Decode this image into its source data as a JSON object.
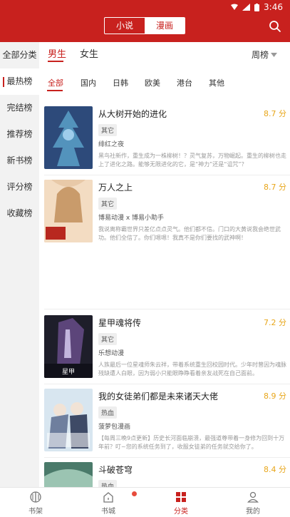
{
  "status": {
    "time": "3:46"
  },
  "header": {
    "segments": [
      {
        "label": "小说"
      },
      {
        "label": "漫画"
      }
    ],
    "active_segment": "漫画"
  },
  "sidebar": {
    "items": [
      {
        "label": "全部分类"
      },
      {
        "label": "最热榜"
      },
      {
        "label": "完结榜"
      },
      {
        "label": "推荐榜"
      },
      {
        "label": "新书榜"
      },
      {
        "label": "评分榜"
      },
      {
        "label": "收藏榜"
      }
    ],
    "active": "最热榜"
  },
  "filters": {
    "genders": [
      {
        "label": "男生"
      },
      {
        "label": "女生"
      }
    ],
    "rank_label": "周榜",
    "categories": [
      {
        "label": "全部"
      },
      {
        "label": "国内"
      },
      {
        "label": "日韩"
      },
      {
        "label": "欧美"
      },
      {
        "label": "港台"
      },
      {
        "label": "其他"
      }
    ]
  },
  "books": [
    {
      "title": "从大树开始的进化",
      "score": "8.7 分",
      "tag": "其它",
      "author": "绯红之夜",
      "desc": "黑鸟社新作，重生成为一株柳树！？灵气复苏，万物崛起。重生的柳树也走上了进化之路。能够无限进化的它，是“神力”还是“诅咒”？",
      "cover_colors": [
        "#2d4a7a",
        "#5aa0c8"
      ]
    },
    {
      "title": "万人之上",
      "score": "8.7 分",
      "tag": "其它",
      "author": "博易动漫 x 博易小助手",
      "desc": "我说离称霸世界只差亿点点灵气。他们都不信。门口的大黄说我会绝世武功。他们全信了。你们嗯嗯！我真不是你们要找的武神啊！",
      "cover_colors": [
        "#e8c9a8",
        "#b87b5a"
      ]
    },
    {
      "title": "星甲魂将传",
      "score": "7.2 分",
      "tag": "其它",
      "author": "乐想动漫",
      "desc": "人族最后一位星魂师朱云祥，带着系统重生回校园时代。少年时曾因为魂脉残缺遭人白眼，因为弱小只能眼睁睁看着亲友战死在自己面前。",
      "cover_colors": [
        "#1e1e2a",
        "#6b4f8e"
      ]
    },
    {
      "title": "我的女徒弟们都是未来诸天大佬",
      "score": "8.9 分",
      "tag": "热血",
      "author": "菠萝包漫画",
      "desc": "【每周三晚9点更新】历史长河面临崩溃，最强道尊带着一身修为回到十万年前？叮~您的系统任务到了，收服女徒弟的任务就交给你了。",
      "cover_colors": [
        "#d8e6f0",
        "#6f7f9e"
      ]
    },
    {
      "title": "斗破苍穹",
      "score": "8.4 分",
      "tag": "热血",
      "author": "",
      "desc": "",
      "cover_colors": [
        "#4a7a6a",
        "#9bc4b2"
      ]
    }
  ],
  "bottom_nav": {
    "items": [
      {
        "label": "书架"
      },
      {
        "label": "书城"
      },
      {
        "label": "分类"
      },
      {
        "label": "我的"
      }
    ],
    "active": "分类"
  },
  "colors": {
    "brand": "#c8211e",
    "score": "#e8a61a"
  }
}
